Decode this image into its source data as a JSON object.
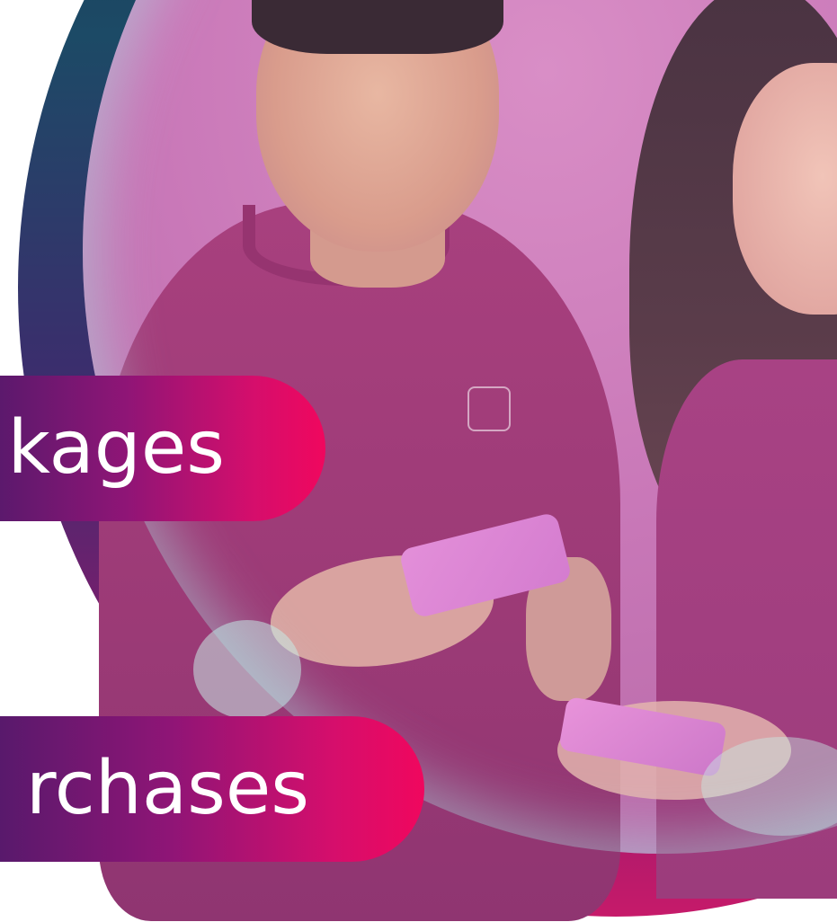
{
  "banners": [
    {
      "label": "kages"
    },
    {
      "label": "rchases"
    }
  ],
  "colors": {
    "pill_gradient_start": "#4d1a6a",
    "pill_gradient_mid": "#8f1576",
    "pill_gradient_end": "#f0075e",
    "ring_top": "#16304a",
    "ring_bottom": "#c61a6a",
    "photo_tint": "#c978b8"
  }
}
